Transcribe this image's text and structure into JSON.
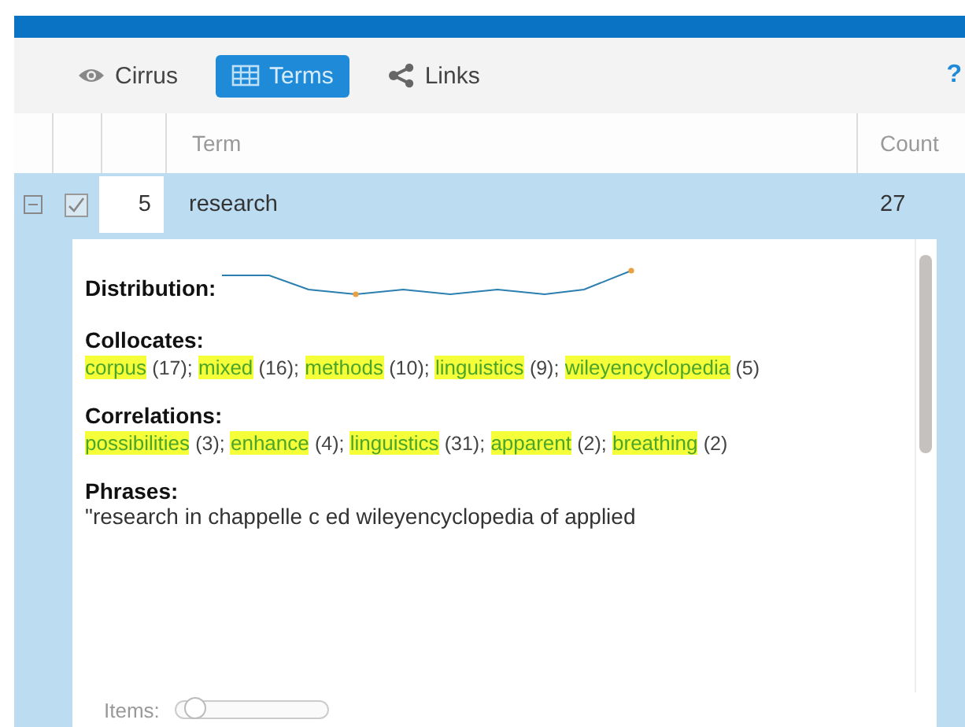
{
  "tabs": [
    {
      "label": "Cirrus",
      "selected": false
    },
    {
      "label": "Terms",
      "selected": true
    },
    {
      "label": "Links",
      "selected": false
    }
  ],
  "help": "?",
  "table": {
    "columns": [
      "Term",
      "Count"
    ],
    "rows": [
      {
        "expanded": true,
        "checked": true,
        "index": "5",
        "term": "research",
        "count": "27"
      }
    ]
  },
  "details": {
    "distribution_label": "Distribution:",
    "collocates_label": "Collocates:",
    "collocates": [
      {
        "term": "corpus",
        "count": "(17);"
      },
      {
        "term": "mixed",
        "count": "(16);"
      },
      {
        "term": "methods",
        "count": "(10);"
      },
      {
        "term": "linguistics",
        "count": "(9);"
      },
      {
        "term": "wileyencyclopedia",
        "count": "(5)"
      }
    ],
    "correlations_label": "Correlations:",
    "correlations": [
      {
        "term": "possibilities",
        "count": "(3);"
      },
      {
        "term": "enhance",
        "count": "(4);"
      },
      {
        "term": "linguistics",
        "count": "(31);"
      },
      {
        "term": "apparent",
        "count": "(2);"
      },
      {
        "term": "breathing",
        "count": "(2)"
      }
    ],
    "phrases_label": "Phrases:",
    "phrase": "\"research in chappelle c ed wileyencyclopedia of applied"
  },
  "items": {
    "label": "Items:",
    "level": 0.05
  }
}
